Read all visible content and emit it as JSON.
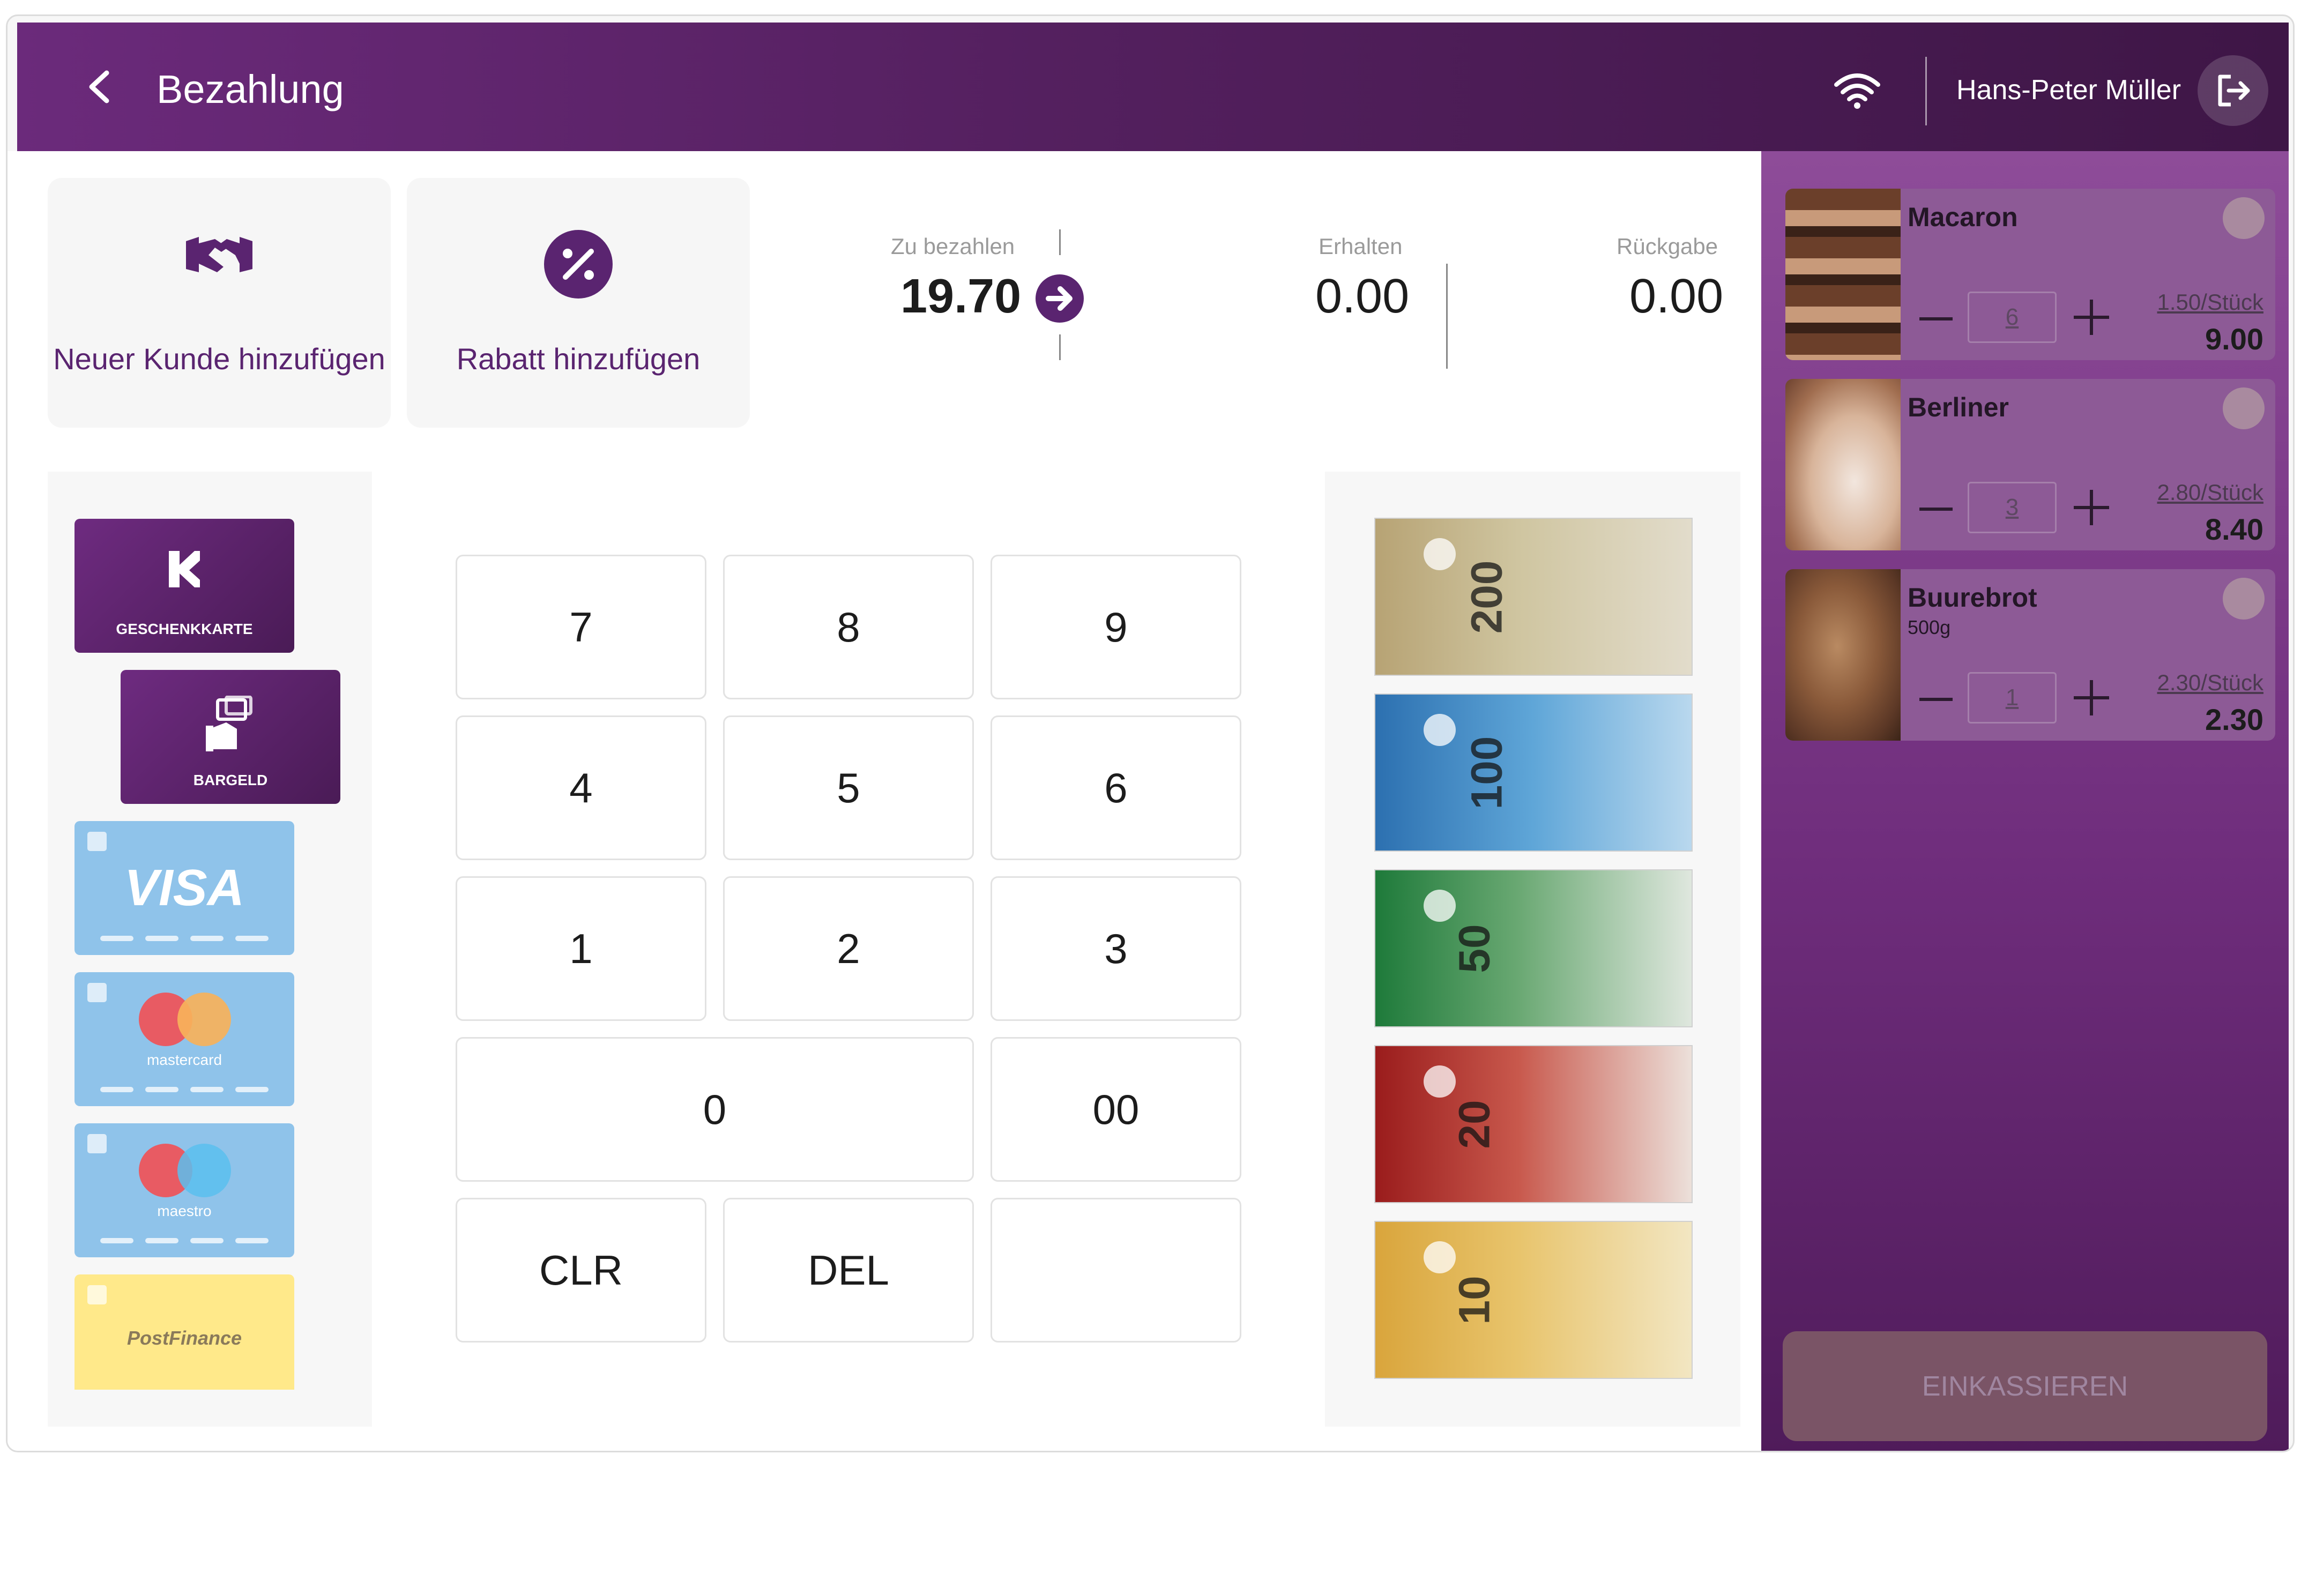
{
  "header": {
    "title": "Bezahlung",
    "user_name": "Hans-Peter Müller",
    "icons": [
      "chevron-left-icon",
      "wifi-icon",
      "logout-icon"
    ]
  },
  "actions": {
    "new_customer": "Neuer Kunde hinzufügen",
    "discount": "Rabatt hinzufügen"
  },
  "summary": {
    "due_label": "Zu bezahlen",
    "due_value": "19.70",
    "received_label": "Erhalten",
    "received_value": "0.00",
    "change_label": "Rückgabe",
    "change_value": "0.00"
  },
  "payment_methods": {
    "giftcard": "GESCHENKKARTE",
    "cash": "BARGELD",
    "visa": "VISA",
    "mastercard": "mastercard",
    "maestro": "maestro",
    "postfinance": "PostFinance"
  },
  "keypad": {
    "k7": "7",
    "k8": "8",
    "k9": "9",
    "k4": "4",
    "k5": "5",
    "k6": "6",
    "k1": "1",
    "k2": "2",
    "k3": "3",
    "k0": "0",
    "k00": "00",
    "clr": "CLR",
    "del": "DEL"
  },
  "banknotes": [
    "200",
    "100",
    "50",
    "20",
    "10"
  ],
  "cart": {
    "items": [
      {
        "name": "Macaron",
        "sub": "",
        "qty": "6",
        "unit": "1.50/Stück",
        "total": "9.00"
      },
      {
        "name": "Berliner",
        "sub": "",
        "qty": "3",
        "unit": "2.80/Stück",
        "total": "8.40"
      },
      {
        "name": "Buurebrot",
        "sub": "500g",
        "qty": "1",
        "unit": "2.30/Stück",
        "total": "2.30"
      }
    ],
    "checkout_label": "EINKASSIEREN"
  },
  "colors": {
    "brand_purple": "#5a2470",
    "header_gradient_start": "#6b2a7b",
    "header_gradient_end": "#3e1646",
    "card_blue": "#8fc3ea",
    "card_yellow": "#ffe98a"
  }
}
